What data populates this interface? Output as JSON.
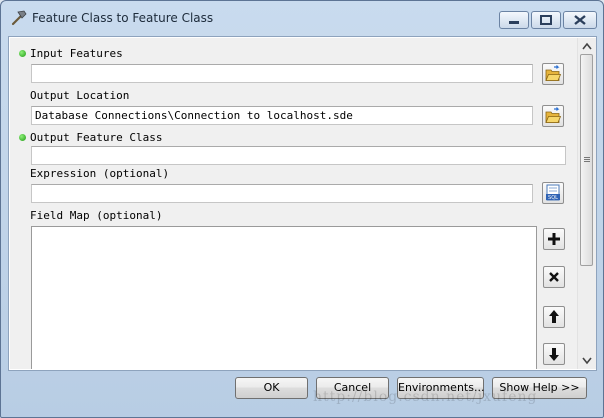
{
  "window": {
    "title": "Feature Class to Feature Class",
    "icon": "hammer-icon"
  },
  "form": {
    "input_features": {
      "label": "Input Features",
      "required": true,
      "value": ""
    },
    "output_location": {
      "label": "Output Location",
      "value": "Database Connections\\Connection to localhost.sde"
    },
    "output_feature_class": {
      "label": "Output Feature Class",
      "required": true,
      "value": ""
    },
    "expression": {
      "label": "Expression (optional)",
      "value": ""
    },
    "field_map": {
      "label": "Field Map (optional)"
    },
    "sql_icon_text": "SQL"
  },
  "buttons": {
    "ok": "OK",
    "cancel": "Cancel",
    "environments": "Environments...",
    "show_help": "Show Help >>"
  },
  "watermark": "http://blog.csdn.net/jxufeng",
  "colors": {
    "required_dot": "#1f9a14",
    "frame": "#b8cde4"
  }
}
